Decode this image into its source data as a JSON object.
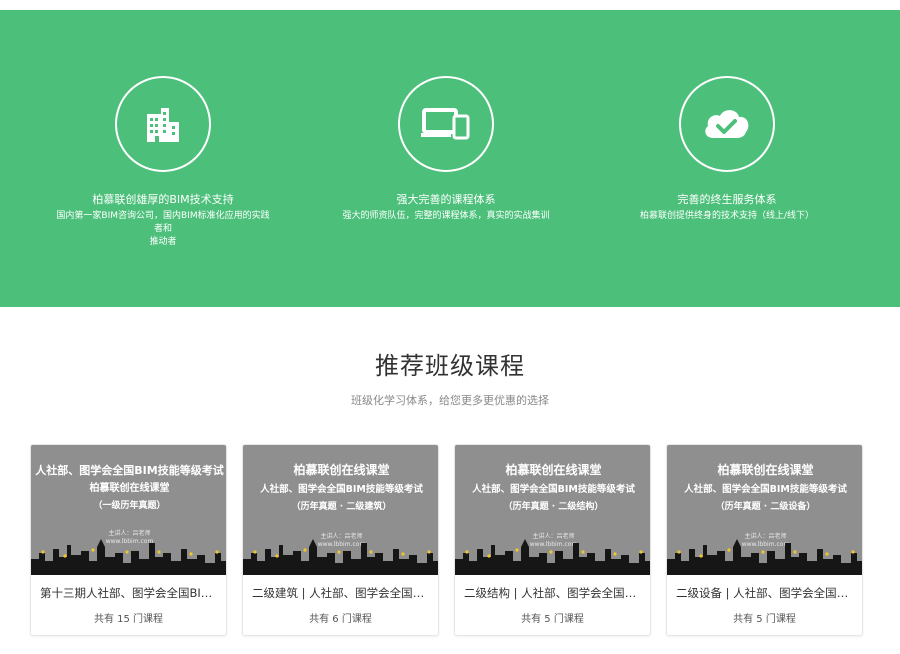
{
  "hero": {
    "features": [
      {
        "icon": "building-icon",
        "title": "柏慕联创雄厚的BIM技术支持",
        "desc": [
          "国内第一家BIM咨询公司，国内BIM标准化应用的实践者和",
          "推动者"
        ]
      },
      {
        "icon": "devices-icon",
        "title": "强大完善的课程体系",
        "desc": [
          "强大的师资队伍，完整的课程体系，真实的实战集训"
        ]
      },
      {
        "icon": "cloud-check-icon",
        "title": "完善的终生服务体系",
        "desc": [
          "柏慕联创提供终身的技术支持（线上/线下）"
        ]
      }
    ]
  },
  "section": {
    "title": "推荐班级课程",
    "subtitle": "班级化学习体系，给您更多更优惠的选择"
  },
  "cards": [
    {
      "thumb_l1": "人社部、图学会全国BIM技能等级考试",
      "thumb_l2": "柏慕联创在线课堂",
      "thumb_l3": "（一级历年真题）",
      "thumb_presenter": "主讲人：吕老师",
      "thumb_site": "www.lbbim.com",
      "title": "第十三期人社部、图学会全国BIM技能等级考试",
      "count": "共有 15 门课程"
    },
    {
      "thumb_l1": "柏慕联创在线课堂",
      "thumb_l2": "人社部、图学会全国BIM技能等级考试",
      "thumb_l3": "（历年真题 · 二级建筑）",
      "thumb_presenter": "主讲人：吕老师",
      "thumb_site": "www.lbbim.com",
      "title": "二级建筑 | 人社部、图学会全国BIM技能等级考试",
      "count": "共有 6 门课程"
    },
    {
      "thumb_l1": "柏慕联创在线课堂",
      "thumb_l2": "人社部、图学会全国BIM技能等级考试",
      "thumb_l3": "（历年真题 · 二级结构）",
      "thumb_presenter": "主讲人：吕老师",
      "thumb_site": "www.lbbim.com",
      "title": "二级结构 | 人社部、图学会全国BIM技能等级考试",
      "count": "共有 5 门课程"
    },
    {
      "thumb_l1": "柏慕联创在线课堂",
      "thumb_l2": "人社部、图学会全国BIM技能等级考试",
      "thumb_l3": "（历年真题 · 二级设备）",
      "thumb_presenter": "主讲人：吕老师",
      "thumb_site": "www.lbbim.com",
      "title": "二级设备 | 人社部、图学会全国BIM技能等级考试",
      "count": "共有 5 门课程"
    }
  ],
  "colors": {
    "hero_green": "#4cc07a",
    "thumb_gray": "#8f8f8f"
  }
}
